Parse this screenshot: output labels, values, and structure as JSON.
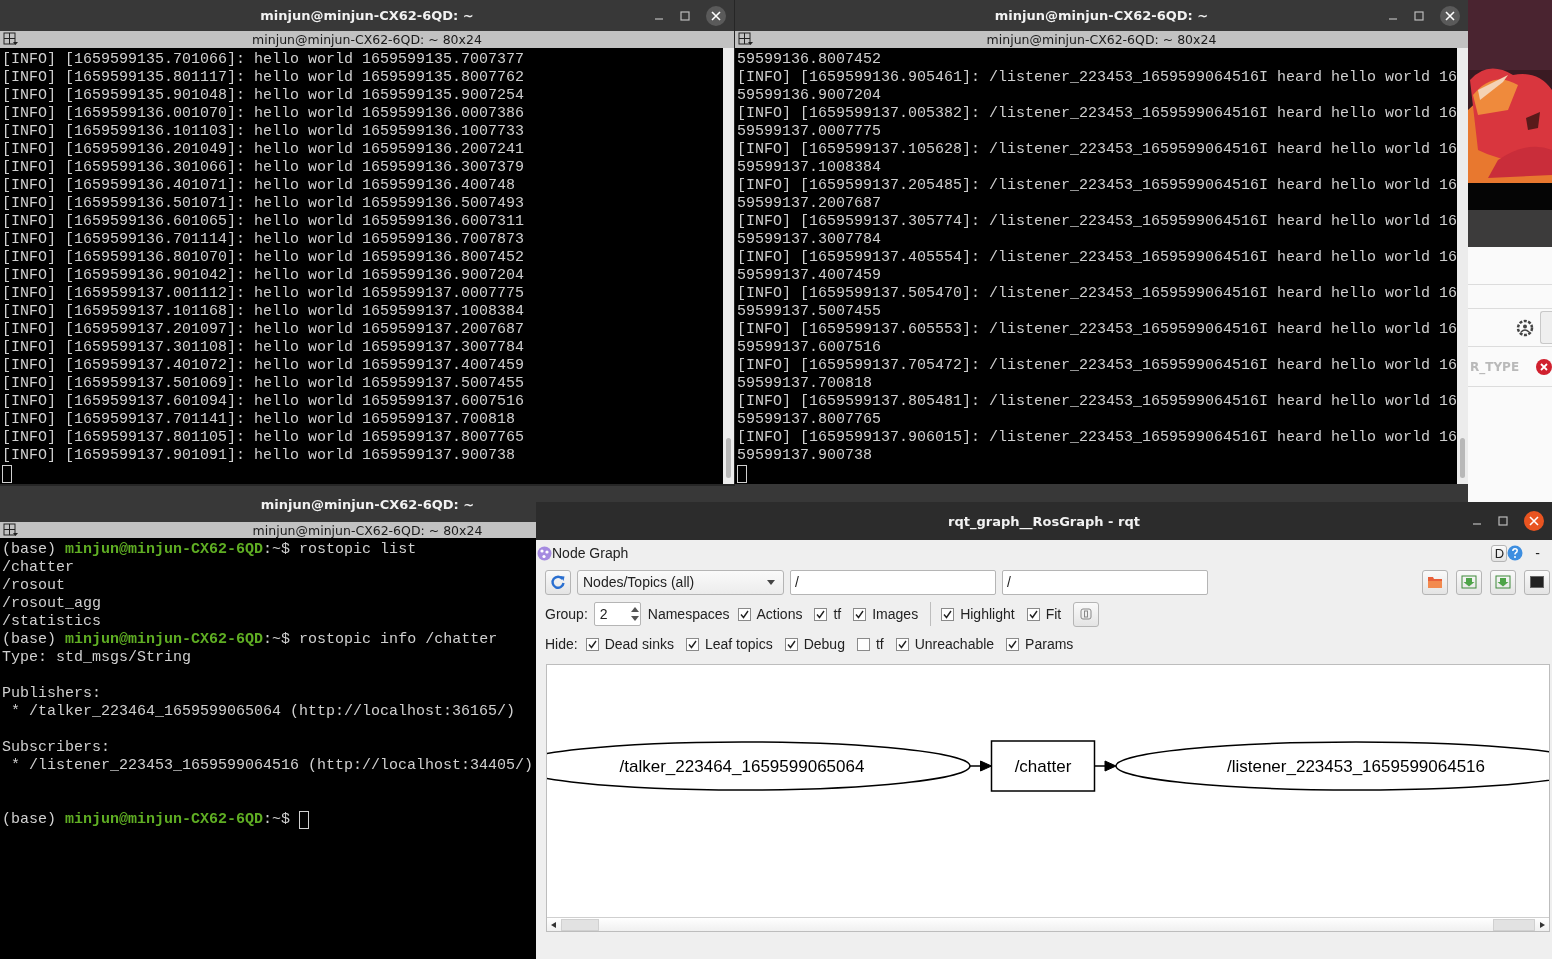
{
  "terminals": [
    {
      "title": "minjun@minjun-CX62-6QD: ~",
      "tab_title": "minjun@minjun-CX62-6QD: ~ 80x24",
      "lines": [
        {
          "kind": "output",
          "text": "[INFO] [1659599135.701066]: hello world 1659599135.7007377"
        },
        {
          "kind": "output",
          "text": "[INFO] [1659599135.801117]: hello world 1659599135.8007762"
        },
        {
          "kind": "output",
          "text": "[INFO] [1659599135.901048]: hello world 1659599135.9007254"
        },
        {
          "kind": "output",
          "text": "[INFO] [1659599136.001070]: hello world 1659599136.0007386"
        },
        {
          "kind": "output",
          "text": "[INFO] [1659599136.101103]: hello world 1659599136.1007733"
        },
        {
          "kind": "output",
          "text": "[INFO] [1659599136.201049]: hello world 1659599136.2007241"
        },
        {
          "kind": "output",
          "text": "[INFO] [1659599136.301066]: hello world 1659599136.3007379"
        },
        {
          "kind": "output",
          "text": "[INFO] [1659599136.401071]: hello world 1659599136.400748"
        },
        {
          "kind": "output",
          "text": "[INFO] [1659599136.501071]: hello world 1659599136.5007493"
        },
        {
          "kind": "output",
          "text": "[INFO] [1659599136.601065]: hello world 1659599136.6007311"
        },
        {
          "kind": "output",
          "text": "[INFO] [1659599136.701114]: hello world 1659599136.7007873"
        },
        {
          "kind": "output",
          "text": "[INFO] [1659599136.801070]: hello world 1659599136.8007452"
        },
        {
          "kind": "output",
          "text": "[INFO] [1659599136.901042]: hello world 1659599136.9007204"
        },
        {
          "kind": "output",
          "text": "[INFO] [1659599137.001112]: hello world 1659599137.0007775"
        },
        {
          "kind": "output",
          "text": "[INFO] [1659599137.101168]: hello world 1659599137.1008384"
        },
        {
          "kind": "output",
          "text": "[INFO] [1659599137.201097]: hello world 1659599137.2007687"
        },
        {
          "kind": "output",
          "text": "[INFO] [1659599137.301108]: hello world 1659599137.3007784"
        },
        {
          "kind": "output",
          "text": "[INFO] [1659599137.401072]: hello world 1659599137.4007459"
        },
        {
          "kind": "output",
          "text": "[INFO] [1659599137.501069]: hello world 1659599137.5007455"
        },
        {
          "kind": "output",
          "text": "[INFO] [1659599137.601094]: hello world 1659599137.6007516"
        },
        {
          "kind": "output",
          "text": "[INFO] [1659599137.701141]: hello world 1659599137.700818"
        },
        {
          "kind": "output",
          "text": "[INFO] [1659599137.801105]: hello world 1659599137.8007765"
        },
        {
          "kind": "output",
          "text": "[INFO] [1659599137.901091]: hello world 1659599137.900738"
        },
        {
          "kind": "cursor"
        }
      ]
    },
    {
      "title": "minjun@minjun-CX62-6QD: ~",
      "tab_title": "minjun@minjun-CX62-6QD: ~ 80x24",
      "lines": [
        {
          "kind": "output",
          "text": "59599136.8007452"
        },
        {
          "kind": "output",
          "text": "[INFO] [1659599136.905461]: /listener_223453_1659599064516I heard hello world 16"
        },
        {
          "kind": "output",
          "text": "59599136.9007204"
        },
        {
          "kind": "output",
          "text": "[INFO] [1659599137.005382]: /listener_223453_1659599064516I heard hello world 16"
        },
        {
          "kind": "output",
          "text": "59599137.0007775"
        },
        {
          "kind": "output",
          "text": "[INFO] [1659599137.105628]: /listener_223453_1659599064516I heard hello world 16"
        },
        {
          "kind": "output",
          "text": "59599137.1008384"
        },
        {
          "kind": "output",
          "text": "[INFO] [1659599137.205485]: /listener_223453_1659599064516I heard hello world 16"
        },
        {
          "kind": "output",
          "text": "59599137.2007687"
        },
        {
          "kind": "output",
          "text": "[INFO] [1659599137.305774]: /listener_223453_1659599064516I heard hello world 16"
        },
        {
          "kind": "output",
          "text": "59599137.3007784"
        },
        {
          "kind": "output",
          "text": "[INFO] [1659599137.405554]: /listener_223453_1659599064516I heard hello world 16"
        },
        {
          "kind": "output",
          "text": "59599137.4007459"
        },
        {
          "kind": "output",
          "text": "[INFO] [1659599137.505470]: /listener_223453_1659599064516I heard hello world 16"
        },
        {
          "kind": "output",
          "text": "59599137.5007455"
        },
        {
          "kind": "output",
          "text": "[INFO] [1659599137.605553]: /listener_223453_1659599064516I heard hello world 16"
        },
        {
          "kind": "output",
          "text": "59599137.6007516"
        },
        {
          "kind": "output",
          "text": "[INFO] [1659599137.705472]: /listener_223453_1659599064516I heard hello world 16"
        },
        {
          "kind": "output",
          "text": "59599137.700818"
        },
        {
          "kind": "output",
          "text": "[INFO] [1659599137.805481]: /listener_223453_1659599064516I heard hello world 16"
        },
        {
          "kind": "output",
          "text": "59599137.8007765"
        },
        {
          "kind": "output",
          "text": "[INFO] [1659599137.906015]: /listener_223453_1659599064516I heard hello world 16"
        },
        {
          "kind": "output",
          "text": "59599137.900738"
        },
        {
          "kind": "cursor"
        }
      ]
    },
    {
      "title": "minjun@minjun-CX62-6QD: ~",
      "tab_title": "minjun@minjun-CX62-6QD: ~ 80x24",
      "lines": [
        {
          "kind": "prompt",
          "env": "(base)",
          "user": "minjun@minjun-CX62-6QD",
          "path": ":~$",
          "command": "rostopic list",
          "cursor": false
        },
        {
          "kind": "output",
          "text": "/chatter"
        },
        {
          "kind": "output",
          "text": "/rosout"
        },
        {
          "kind": "output",
          "text": "/rosout_agg"
        },
        {
          "kind": "output",
          "text": "/statistics"
        },
        {
          "kind": "prompt",
          "env": "(base)",
          "user": "minjun@minjun-CX62-6QD",
          "path": ":~$",
          "command": "rostopic info /chatter",
          "cursor": false
        },
        {
          "kind": "output",
          "text": "Type: std_msgs/String"
        },
        {
          "kind": "blank"
        },
        {
          "kind": "output",
          "text": "Publishers:"
        },
        {
          "kind": "output",
          "text": " * /talker_223464_1659599065064 (http://localhost:36165/)"
        },
        {
          "kind": "blank"
        },
        {
          "kind": "output",
          "text": "Subscribers:"
        },
        {
          "kind": "output",
          "text": " * /listener_223453_1659599064516 (http://localhost:34405/)"
        },
        {
          "kind": "blank"
        },
        {
          "kind": "blank"
        },
        {
          "kind": "prompt",
          "env": "(base)",
          "user": "minjun@minjun-CX62-6QD",
          "path": ":~$",
          "cursor": true
        }
      ]
    }
  ],
  "background_window": {
    "label": "R_TYPE"
  },
  "rqt": {
    "title": "rqt_graph__RosGraph - rqt",
    "plugin_title": "Node Graph",
    "d_button": "D",
    "dash": "-",
    "combo": "Nodes/Topics (all)",
    "filters": [
      "/",
      "/"
    ],
    "group_label": "Group:",
    "group_value": "2",
    "options": [
      {
        "kind": "text",
        "label": "Namespaces"
      },
      {
        "kind": "checkbox",
        "label": "Actions",
        "checked": true
      },
      {
        "kind": "checkbox",
        "label": "tf",
        "checked": true
      },
      {
        "kind": "checkbox",
        "label": "Images",
        "checked": true
      },
      {
        "kind": "separator"
      },
      {
        "kind": "checkbox",
        "label": "Highlight",
        "checked": true
      },
      {
        "kind": "checkbox",
        "label": "Fit",
        "checked": true
      },
      {
        "kind": "button"
      }
    ],
    "hide_label": "Hide:",
    "hide": [
      {
        "label": "Dead sinks",
        "checked": true
      },
      {
        "label": "Leaf topics",
        "checked": true
      },
      {
        "label": "Debug",
        "checked": true
      },
      {
        "label": "tf",
        "checked": false
      },
      {
        "label": "Unreachable",
        "checked": true
      },
      {
        "label": "Params",
        "checked": true
      }
    ],
    "graph": {
      "nodes": [
        {
          "label": "/talker_223464_1659599065064",
          "kind": "node"
        },
        {
          "label": "/chatter",
          "kind": "topic"
        },
        {
          "label": "/listener_223453_1659599064516",
          "kind": "node"
        }
      ]
    }
  }
}
